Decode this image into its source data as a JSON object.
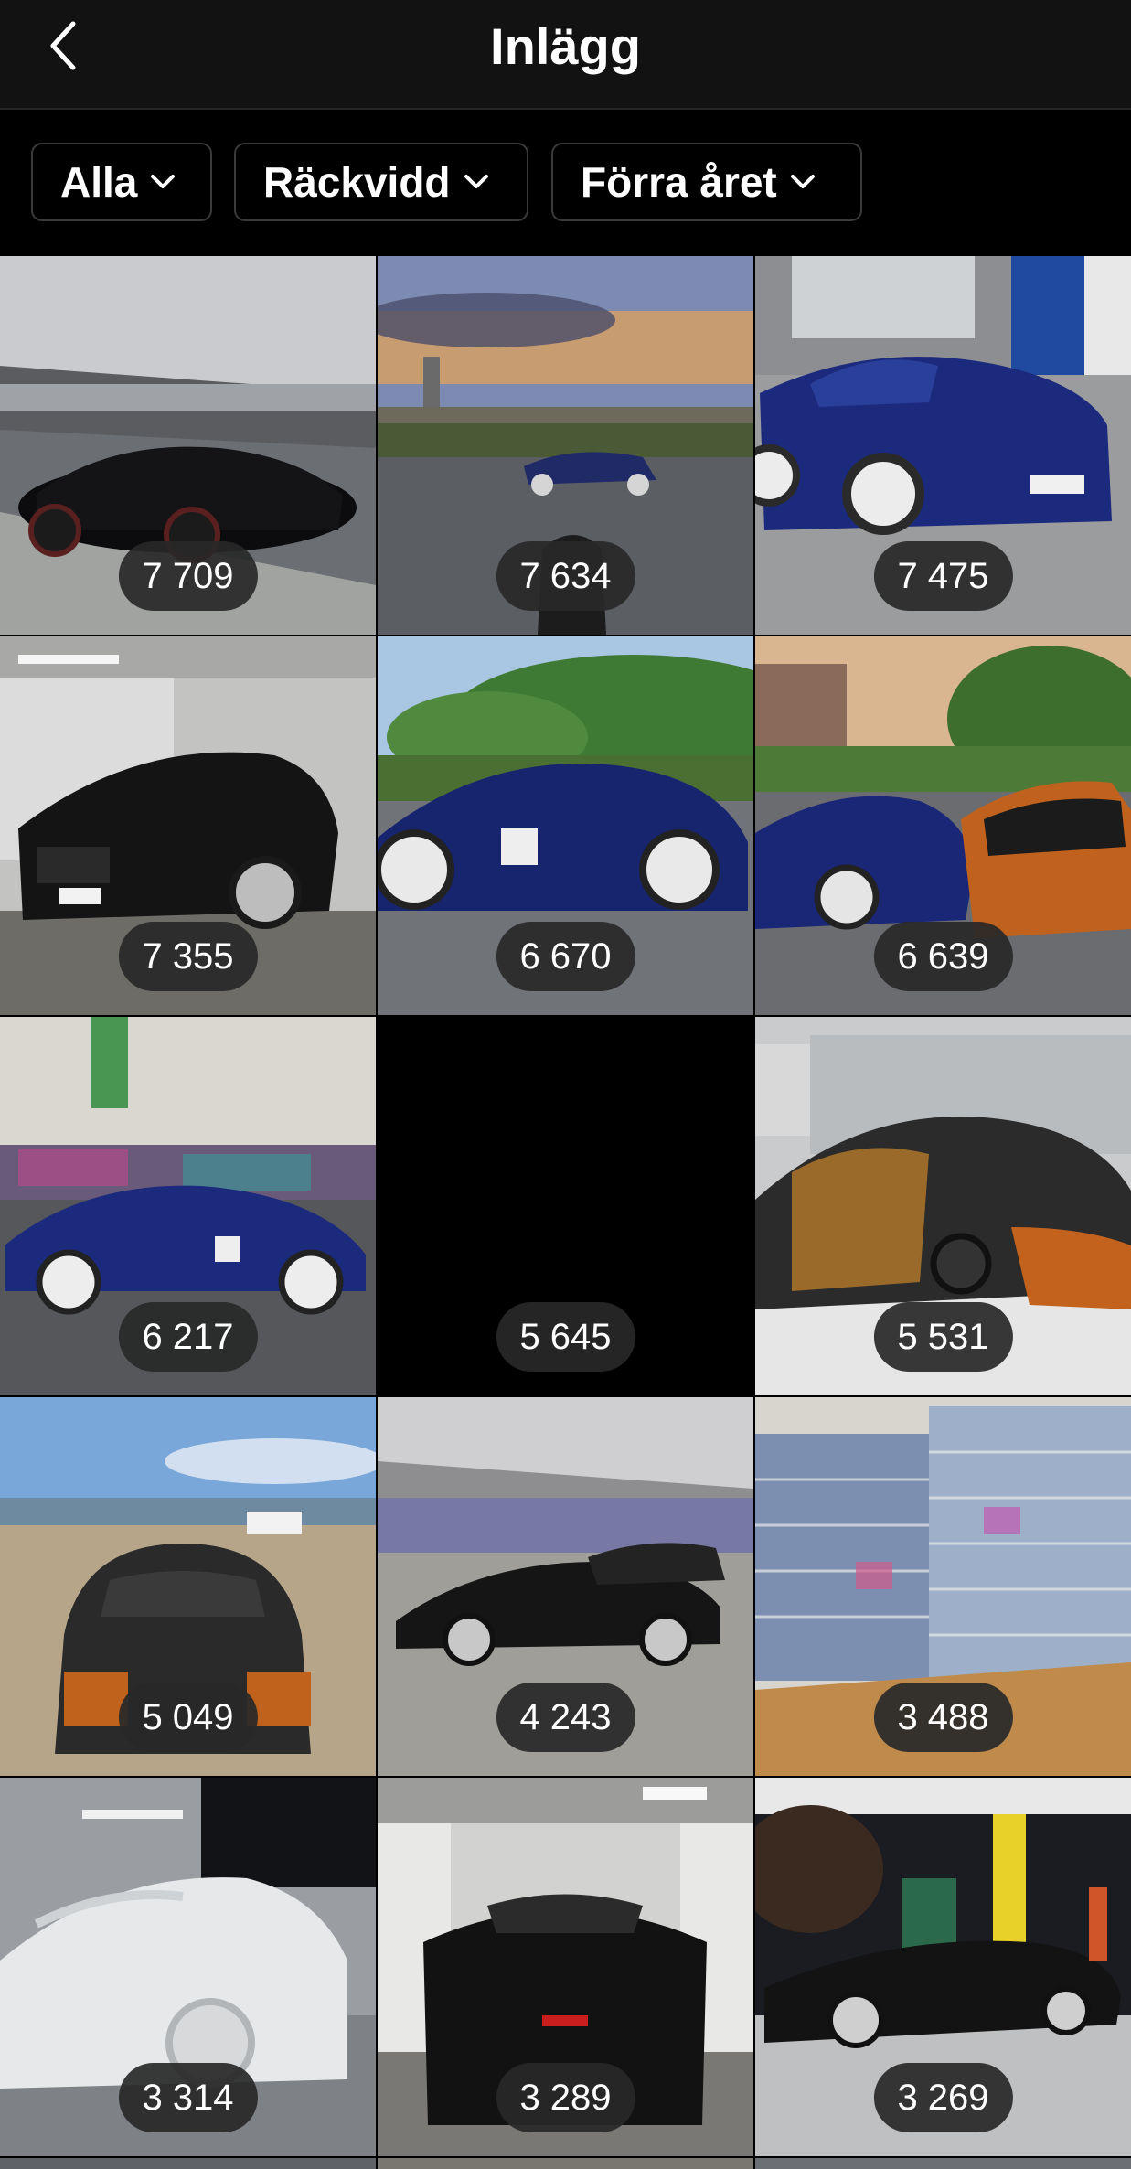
{
  "header": {
    "title": "Inlägg",
    "back_icon": "chevron-left-icon"
  },
  "filters": [
    {
      "label": "Alla",
      "icon": "chevron-down-icon"
    },
    {
      "label": "Räckvidd",
      "icon": "chevron-down-icon"
    },
    {
      "label": "Förra året",
      "icon": "chevron-down-icon"
    }
  ],
  "posts": [
    {
      "reach": "7 709"
    },
    {
      "reach": "7 634"
    },
    {
      "reach": "7 475"
    },
    {
      "reach": "7 355"
    },
    {
      "reach": "6 670"
    },
    {
      "reach": "6 639"
    },
    {
      "reach": "6 217"
    },
    {
      "reach": "5 645"
    },
    {
      "reach": "5 531"
    },
    {
      "reach": "5 049"
    },
    {
      "reach": "4 243"
    },
    {
      "reach": "3 488"
    },
    {
      "reach": "3 314"
    },
    {
      "reach": "3 289"
    },
    {
      "reach": "3 269"
    }
  ]
}
